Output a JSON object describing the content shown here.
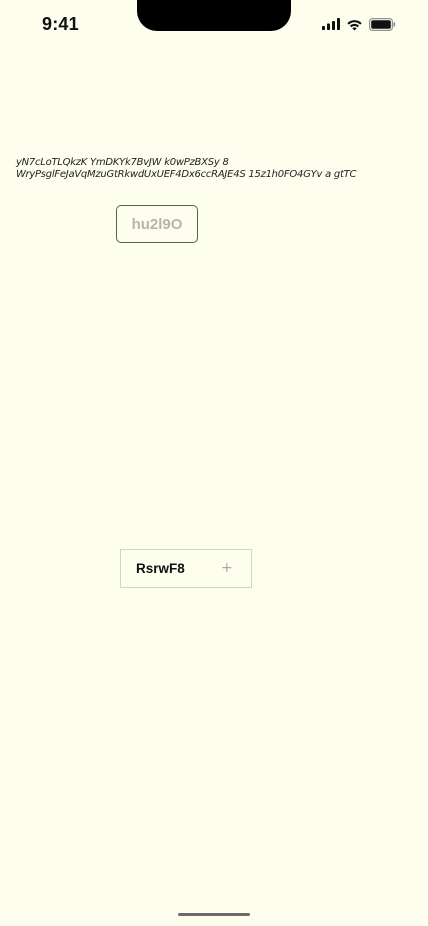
{
  "status_bar": {
    "time": "9:41",
    "icons": [
      "cellular-signal-icon",
      "wifi-icon",
      "battery-icon"
    ]
  },
  "content": {
    "paragraph": "yN7cLoTLQkzK YmDKYk7BvJW  k0wPzBXSy 8\nWryPsglFeJaVqMzuGtRkwdUxUEF4Dx6ccRAJE4S 15z1h0FO4GYv a gtTC",
    "outline_button_label": "hu2l9O",
    "stepper": {
      "label": "RsrwF8",
      "plus_symbol": "+"
    }
  },
  "colors": {
    "background": "#fefeee",
    "button_border": "#4f6a3c",
    "stepper_border": "#c4dcc4",
    "muted_text": "#b5b5ad"
  }
}
